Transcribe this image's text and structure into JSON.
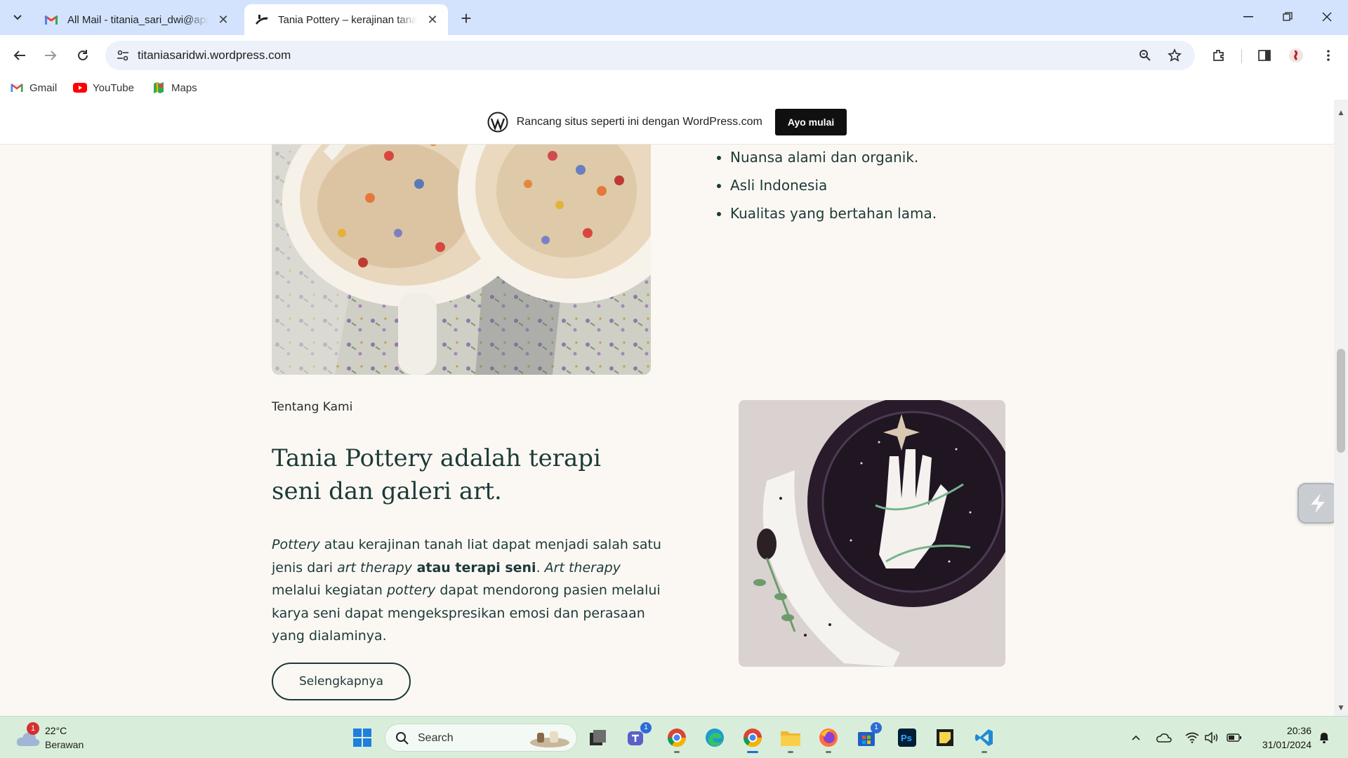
{
  "browser": {
    "tabs": [
      {
        "title": "All Mail - titania_sari_dwi@apps",
        "icon": "gmail-icon"
      },
      {
        "title": "Tania Pottery – kerajinan tanah liat",
        "icon": "pottery-wheel-icon"
      }
    ],
    "url": "titaniasaridwi.wordpress.com",
    "bookmarks": [
      {
        "label": "Gmail",
        "icon": "gmail-icon"
      },
      {
        "label": "YouTube",
        "icon": "youtube-icon"
      },
      {
        "label": "Maps",
        "icon": "maps-icon"
      }
    ]
  },
  "banner": {
    "text": "Rancang situs seperti ini dengan WordPress.com",
    "button": "Ayo mulai"
  },
  "features": [
    "Nuansa alami dan organik.",
    "Asli Indonesia",
    "Kualitas yang bertahan lama."
  ],
  "about": {
    "label": "Tentang Kami",
    "heading": "Tania Pottery adalah terapi seni dan galeri art.",
    "body": {
      "p1": "Pottery",
      "p2": " atau kerajinan tanah liat dapat menjadi salah satu jenis dari ",
      "p3": "art therapy",
      "p4": " atau terapi seni",
      "p5": ". ",
      "p6": "Art therapy",
      "p7": " melalui kegiatan ",
      "p8": "pottery",
      "p9": " dapat mendorong pasien melalui karya seni dapat mengekspresikan emosi dan perasaan yang dialaminya."
    },
    "button": "Selengkapnya"
  },
  "taskbar": {
    "weather": {
      "temp": "22°C",
      "condition": "Berawan",
      "badge": "1"
    },
    "search": "Search",
    "badges": {
      "teams": "1",
      "store": "1"
    },
    "time": "20:36",
    "date": "31/01/2024"
  },
  "colors": {
    "page_bg": "#fbf8f4",
    "text_teal": "#1c3a36",
    "tab_strip": "#d3e3fd",
    "taskbar": "#d8eeda"
  }
}
